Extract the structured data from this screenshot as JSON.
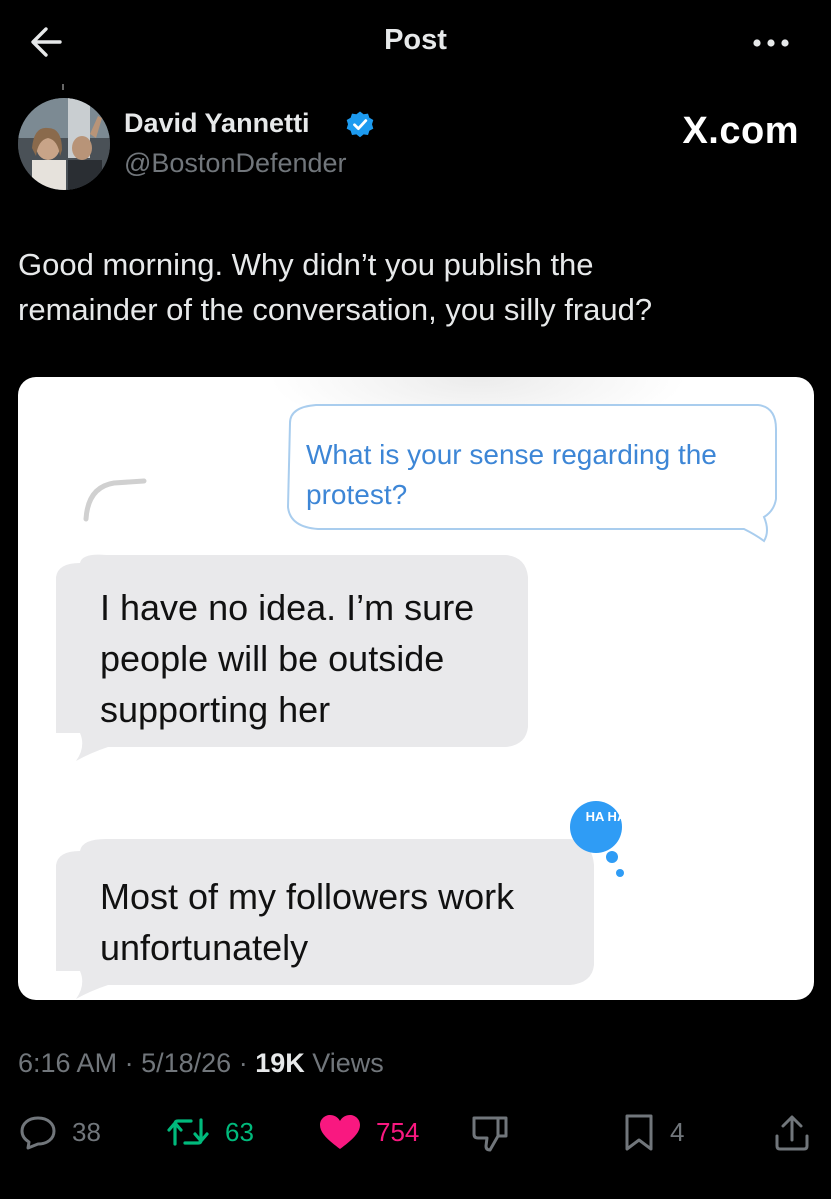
{
  "header": {
    "title": "Post",
    "back_icon": "arrow-left-icon",
    "more_icon": "more-horizontal-icon"
  },
  "author": {
    "name": "David Yannetti",
    "handle": "@BostonDefender",
    "verified": true,
    "badge_color": "#1d9bf0"
  },
  "watermark": "X.com",
  "tweet": {
    "text": "Good morning.  Why didn’t you publish the\nremainder of the conversation, you silly fraud?"
  },
  "media": {
    "messages": [
      {
        "direction": "sent",
        "text": "What is your sense regarding the protest?"
      },
      {
        "direction": "received",
        "text": "I have no idea. I’m sure people will be outside supporting her"
      },
      {
        "direction": "received",
        "text": "Most of my followers work unfortunately",
        "reaction": "HA HA"
      }
    ]
  },
  "meta": {
    "time": "6:16 AM",
    "sep1": "·",
    "date": "5/18/26",
    "sep2": "·",
    "views_count": "19K",
    "views_label": "Views"
  },
  "actions": {
    "reply": {
      "count": "38",
      "icon": "reply-bubble-icon"
    },
    "retweet": {
      "count": "63",
      "icon": "retweet-icon",
      "color": "#00ba7c"
    },
    "like": {
      "count": "754",
      "icon": "heart-icon",
      "color": "#f91880"
    },
    "dislike": {
      "icon": "thumbs-down-icon"
    },
    "bookmark": {
      "count": "4",
      "icon": "bookmark-icon"
    },
    "share": {
      "icon": "share-icon"
    }
  }
}
